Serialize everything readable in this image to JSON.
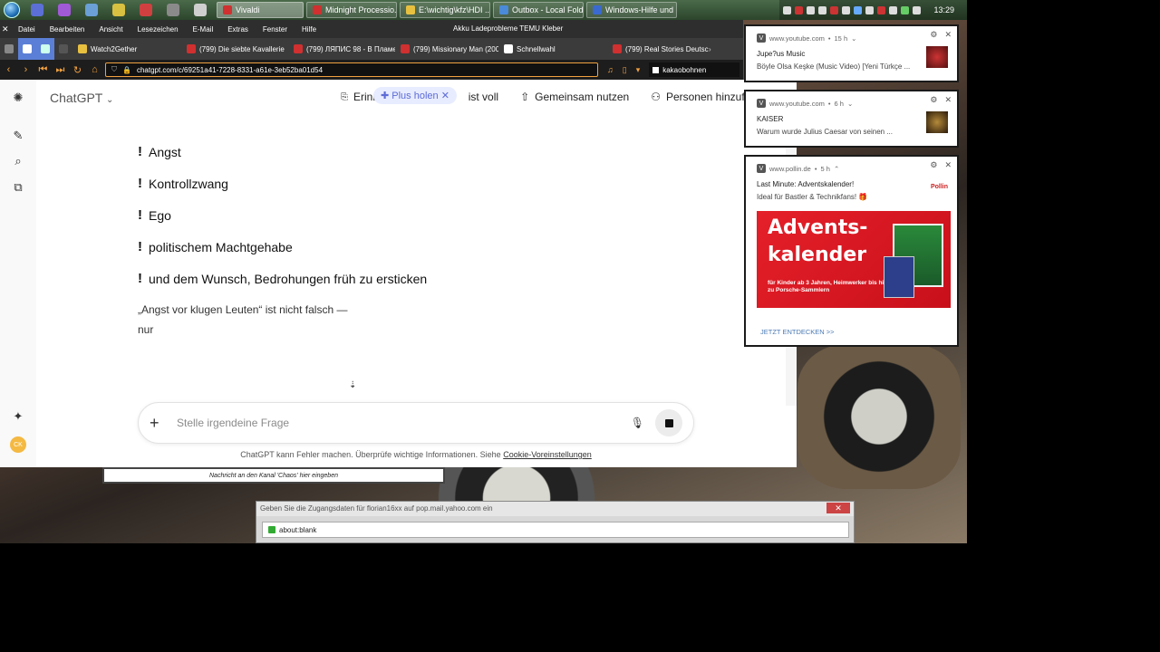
{
  "taskbar": {
    "tasks": [
      {
        "label": "Vivaldi",
        "color": "#d03030"
      },
      {
        "label": "Midnight Processio...",
        "color": "#d03030"
      },
      {
        "label": "E:\\wichtig\\kfz\\HDI ...",
        "color": "#e8c040"
      },
      {
        "label": "Outbox - Local Fold...",
        "color": "#4a8ad8"
      },
      {
        "label": "Windows-Hilfe und ...",
        "color": "#3a6ad0"
      }
    ],
    "clock": "13:29"
  },
  "menubar": {
    "items": [
      "Datei",
      "Bearbeiten",
      "Ansicht",
      "Lesezeichen",
      "E-Mail",
      "Extras",
      "Fenster",
      "Hilfe"
    ],
    "window_title": "Akku Ladeprobleme TEMU Kleber"
  },
  "tabs": [
    {
      "label": "Watch2Gether",
      "color": "#e8c040"
    },
    {
      "label": "(799) Die siebte Kavallerie",
      "color": "#d03030"
    },
    {
      "label": "(799) ЛЯПИС 98 - В Пламе",
      "color": "#d03030"
    },
    {
      "label": "(799) Missionary Man (200",
      "color": "#d03030"
    },
    {
      "label": "Schnellwahl",
      "color": "#ffffff"
    },
    {
      "label": "(799) Real Stories Deutsch",
      "color": "#d03030"
    }
  ],
  "address": {
    "url": "chatgpt.com/c/69251a41-7228-8331-a61e-3eb52ba01d54",
    "bookmark": "kakaobohnen"
  },
  "chatgpt": {
    "model": "ChatGPT",
    "header": {
      "memory": "Erinnerung",
      "memory_pill": "Plus holen",
      "memory_full": "ist voll",
      "share": "Gemeinsam nutzen",
      "add_people": "Personen hinzufügen"
    },
    "bullets": [
      "Angst",
      "Kontrollzwang",
      "Ego",
      "politischem Machtgehabe",
      "und dem Wunsch, Bedrohungen früh zu ersticken"
    ],
    "paragraph_line1": "„Angst vor klugen Leuten“ ist nicht falsch —",
    "paragraph_line2": "nur",
    "composer_placeholder": "Stelle irgendeine Frage",
    "disclaimer": "ChatGPT kann Fehler machen. Überprüfe wichtige Informationen. Siehe",
    "disclaimer_link": "Cookie-Voreinstellungen",
    "avatar_initials": "CK"
  },
  "channel_input": "Nachricht an den Kanal 'Chaos' hier eingeben",
  "dialog": {
    "title": "Geben Sie die Zugangsdaten für florian16xx auf pop.mail.yahoo.com ein",
    "url": "about:blank"
  },
  "notifications": [
    {
      "source": "www.youtube.com",
      "age": "15 h",
      "title": "Jupe?us Music",
      "body": "Böyle Olsa Keşke (Music Video) [Yeni Türkçe ..."
    },
    {
      "source": "www.youtube.com",
      "age": "6 h",
      "title": "KAISER",
      "body": "Warum wurde Julius Caesar von seinen ..."
    },
    {
      "source": "www.pollin.de",
      "age": "5 h",
      "title": "Last Minute: Adventskalender!",
      "body": "Ideal für Bastler & Technikfans! 🎁",
      "brand": "Pollin",
      "banner_line1": "Advents-",
      "banner_line2": "kalender",
      "banner_sub": "für Kinder ab 3 Jahren, Heimwerker bis hin zu Porsche-Sammlern",
      "cta": "JETZT ENTDECKEN >>"
    }
  ]
}
